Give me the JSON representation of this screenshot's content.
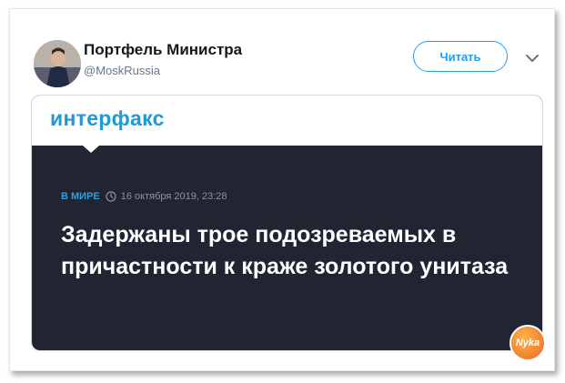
{
  "tweet": {
    "author_name": "Портфель Министра",
    "author_handle": "@MoskRussia",
    "follow_label": "Читать"
  },
  "card": {
    "logo_text": "интерфакс",
    "rubric": "В МИРЕ",
    "date": "16 октября 2019, 23:28",
    "headline": "Задержаны трое подозреваемых в причастности к краже золотого унитаза"
  },
  "watermark": {
    "text": "Nyka"
  },
  "colors": {
    "accent": "#1da1f2",
    "card_background": "#212532",
    "interfax_blue": "#1f9ad6"
  },
  "icons": [
    "avatar-image",
    "chevron-down-icon",
    "clock-icon"
  ]
}
